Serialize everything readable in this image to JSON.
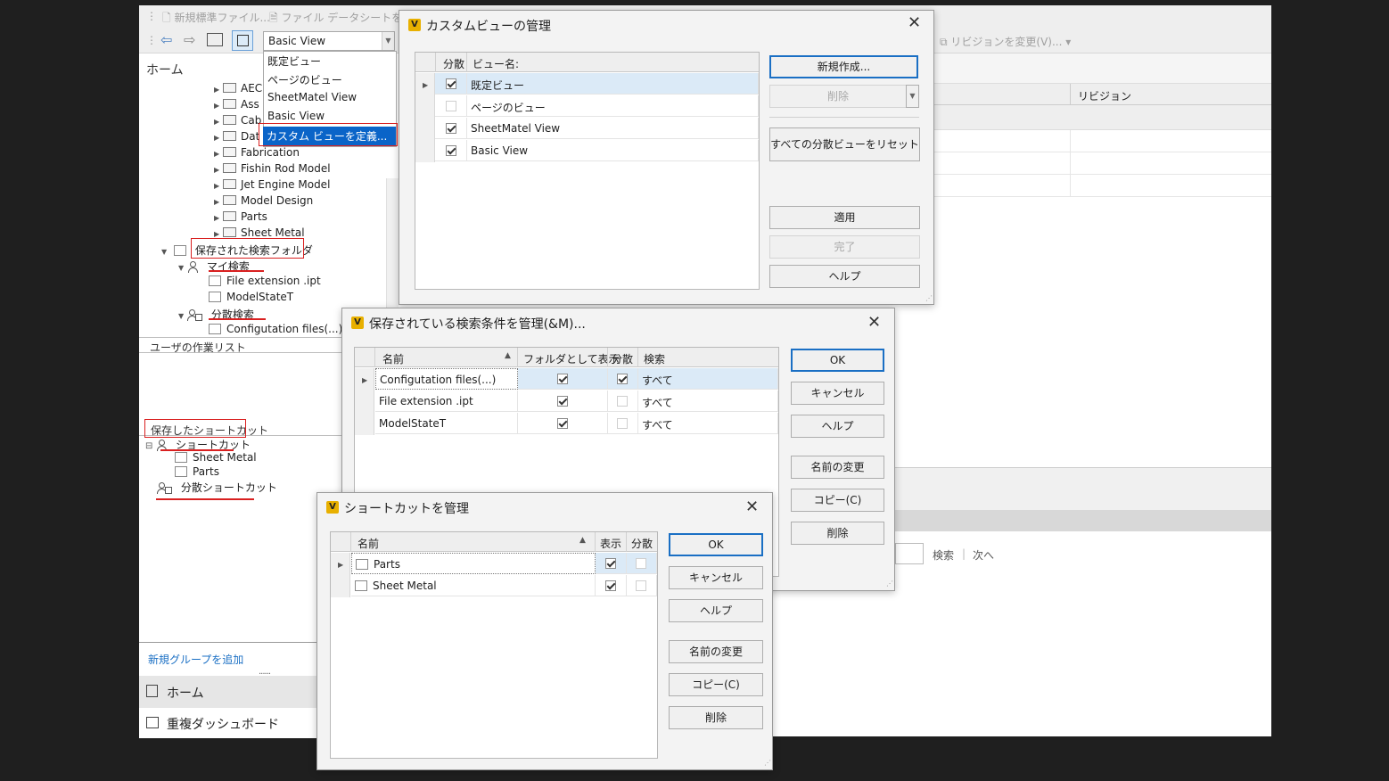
{
  "toolbar": {
    "new_std_file": "新規標準ファイル...",
    "file_datasheet": "ファイル データシートを編集",
    "revision_change": "リビジョンを変更(V)...",
    "view_combo_value": "Basic View"
  },
  "view_dropdown": {
    "items": [
      "既定ビュー",
      "ページのビュー",
      "SheetMatel View",
      "Basic View",
      "カスタム ビューを定義..."
    ]
  },
  "left_pane": {
    "home_label": "ホーム",
    "folders": [
      "AEC",
      "Ass",
      "Cab",
      "Dat",
      "Fabrication",
      "Fishin Rod Model",
      "Jet Engine Model",
      "Model Design",
      "Parts",
      "Sheet Metal"
    ],
    "saved_search_folder": "保存された検索フォルダ",
    "my_search": "マイ検索",
    "my_search_items": [
      "File extension .ipt",
      "ModelStateT"
    ],
    "distributed_search": "分散検索",
    "distributed_search_items": [
      "Configutation files(...)"
    ],
    "user_worklist": "ユーザの作業リスト",
    "saved_shortcuts": "保存したショートカット",
    "shortcut_group": "ショートカット",
    "shortcut_items": [
      "Sheet Metal",
      "Parts"
    ],
    "distributed_shortcut": "分散ショートカット",
    "add_group_link": "新規グループを追加",
    "nav_home": "ホーム",
    "nav_dup_dashboard": "重複ダッシュボード"
  },
  "background_table": {
    "revision_header": "リビジョン",
    "search_label": "検索",
    "next_label": "次へ"
  },
  "custom_view_dialog": {
    "title": "カスタムビューの管理",
    "col_distributed": "分散",
    "col_view_name": "ビュー名:",
    "rows": [
      {
        "name": "既定ビュー",
        "checked": true
      },
      {
        "name": "ページのビュー",
        "checked": false
      },
      {
        "name": "SheetMatel View",
        "checked": true
      },
      {
        "name": "Basic View",
        "checked": true
      }
    ],
    "btn_new": "新規作成...",
    "btn_delete": "削除",
    "btn_reset": "すべての分散ビューをリセット",
    "btn_apply": "適用",
    "btn_done": "完了",
    "btn_help": "ヘルプ"
  },
  "saved_search_dialog": {
    "title": "保存されている検索条件を管理(&M)...",
    "col_name": "名前",
    "col_show_folder": "フォルダとして表示",
    "col_distributed": "分散",
    "col_search": "検索",
    "rows": [
      {
        "name": "Configutation files(...)",
        "folder": true,
        "dist": true,
        "search": "すべて"
      },
      {
        "name": "File extension .ipt",
        "folder": true,
        "dist": false,
        "search": "すべて"
      },
      {
        "name": "ModelStateT",
        "folder": true,
        "dist": false,
        "search": "すべて"
      }
    ],
    "btn_ok": "OK",
    "btn_cancel": "キャンセル",
    "btn_help": "ヘルプ",
    "btn_rename": "名前の変更",
    "btn_copy": "コピー(C)",
    "btn_delete": "削除"
  },
  "shortcut_dialog": {
    "title": "ショートカットを管理",
    "col_name": "名前",
    "col_show": "表示",
    "col_distributed": "分散",
    "rows": [
      {
        "name": "Parts",
        "show": true,
        "dist": false
      },
      {
        "name": "Sheet Metal",
        "show": true,
        "dist": false
      }
    ],
    "btn_ok": "OK",
    "btn_cancel": "キャンセル",
    "btn_help": "ヘルプ",
    "btn_rename": "名前の変更",
    "btn_copy": "コピー(C)",
    "btn_delete": "削除"
  },
  "colors": {
    "accent": "#1a6fc4",
    "highlight_red": "#d92020",
    "selection": "#0a64c8",
    "logo_yellow": "#e8b000"
  }
}
